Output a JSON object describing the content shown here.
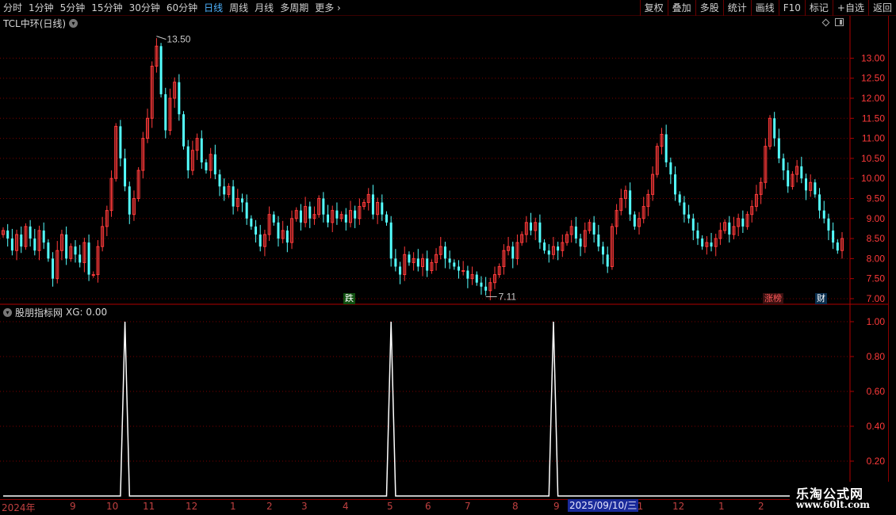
{
  "toolbar": {
    "periods": [
      "分时",
      "1分钟",
      "5分钟",
      "15分钟",
      "30分钟",
      "60分钟",
      "日线",
      "周线",
      "月线",
      "多周期",
      "更多"
    ],
    "active_period": "日线",
    "more_arrow": "›",
    "actions": [
      "复权",
      "叠加",
      "多股",
      "统计",
      "画线",
      "F10",
      "标记",
      "+自选",
      "返回"
    ]
  },
  "main_chart": {
    "title": "TCL中环(日线)",
    "y_ticks": [
      "13.00",
      "12.50",
      "12.00",
      "11.50",
      "11.00",
      "10.50",
      "10.00",
      "9.50",
      "9.00",
      "8.50",
      "8.00",
      "7.50",
      "7.00"
    ],
    "max_label": "13.50",
    "min_label": "7.11",
    "markers": {
      "die": "跌",
      "zhangbang": "涨榜",
      "cai": "财"
    }
  },
  "indicator": {
    "title": "股朋指标网",
    "value_label": "XG: 0.00",
    "y_ticks": [
      "1.00",
      "0.80",
      "0.60",
      "0.40",
      "0.20"
    ]
  },
  "date_axis": {
    "labels": [
      "2024年",
      "9",
      "10",
      "11",
      "12",
      "1",
      "2",
      "3",
      "4",
      "5",
      "6",
      "7",
      "8",
      "9",
      "11",
      "12",
      "1",
      "2"
    ],
    "cursor": "2025/09/10/三"
  },
  "watermark": {
    "title": "乐淘公式网",
    "url": "www.60lt.com"
  },
  "colors": {
    "up": "#ff3a3a",
    "down": "#54ffff",
    "grid": "#7a0000",
    "axis": "#b00000",
    "active_tab": "#4fb4ff",
    "signal": "#ffffff"
  },
  "chart_data": {
    "type": "candlestick",
    "signal_series": {
      "name": "XG",
      "spike_at_index": [
        27,
        86,
        122,
        190
      ],
      "spike_value": 1.0
    },
    "ylim": [
      6.9,
      13.7
    ],
    "closes": [
      8.7,
      8.5,
      8.2,
      8.6,
      8.3,
      8.8,
      8.5,
      8.2,
      8.7,
      8.4,
      8.0,
      7.5,
      8.2,
      8.6,
      8.0,
      8.3,
      8.1,
      7.9,
      8.4,
      7.6,
      7.6,
      8.3,
      8.8,
      9.2,
      10.0,
      11.3,
      10.5,
      9.8,
      9.1,
      9.5,
      10.2,
      11.0,
      11.5,
      12.8,
      13.3,
      12.1,
      11.2,
      12.0,
      12.4,
      11.6,
      10.8,
      10.2,
      10.7,
      11.0,
      10.4,
      10.2,
      10.6,
      10.1,
      9.8,
      9.6,
      9.8,
      9.3,
      9.5,
      9.4,
      9.0,
      8.8,
      8.6,
      8.3,
      8.6,
      9.1,
      8.9,
      8.5,
      8.7,
      8.4,
      9.0,
      9.2,
      8.9,
      9.3,
      9.0,
      9.1,
      9.5,
      9.1,
      8.9,
      9.2,
      9.0,
      9.1,
      8.9,
      9.2,
      9.0,
      9.3,
      9.4,
      9.6,
      9.1,
      9.4,
      9.1,
      8.9,
      8.0,
      7.8,
      7.6,
      8.1,
      7.9,
      8.0,
      7.8,
      8.0,
      7.7,
      7.9,
      8.1,
      8.3,
      8.0,
      7.9,
      7.8,
      7.7,
      7.7,
      7.5,
      7.6,
      7.4,
      7.3,
      7.2,
      7.4,
      7.6,
      7.8,
      8.2,
      8.3,
      8.0,
      8.4,
      8.6,
      8.9,
      8.7,
      8.9,
      8.4,
      8.2,
      8.1,
      8.3,
      8.2,
      8.4,
      8.6,
      8.8,
      8.5,
      8.3,
      8.7,
      8.9,
      8.6,
      8.3,
      8.1,
      7.8,
      8.8,
      9.2,
      9.5,
      9.7,
      9.1,
      8.8,
      9.0,
      9.3,
      9.6,
      10.1,
      10.8,
      11.1,
      10.4,
      10.1,
      9.6,
      9.4,
      9.1,
      9.0,
      8.7,
      8.5,
      8.3,
      8.4,
      8.3,
      8.5,
      8.7,
      8.9,
      8.6,
      8.8,
      9.0,
      8.8,
      9.1,
      9.3,
      9.6,
      9.9,
      10.8,
      11.5,
      11.0,
      10.5,
      10.2,
      9.8,
      10.1,
      10.3,
      10.0,
      9.7,
      9.9,
      9.6,
      9.2,
      9.0,
      8.7,
      8.4,
      8.2,
      8.5
    ]
  }
}
